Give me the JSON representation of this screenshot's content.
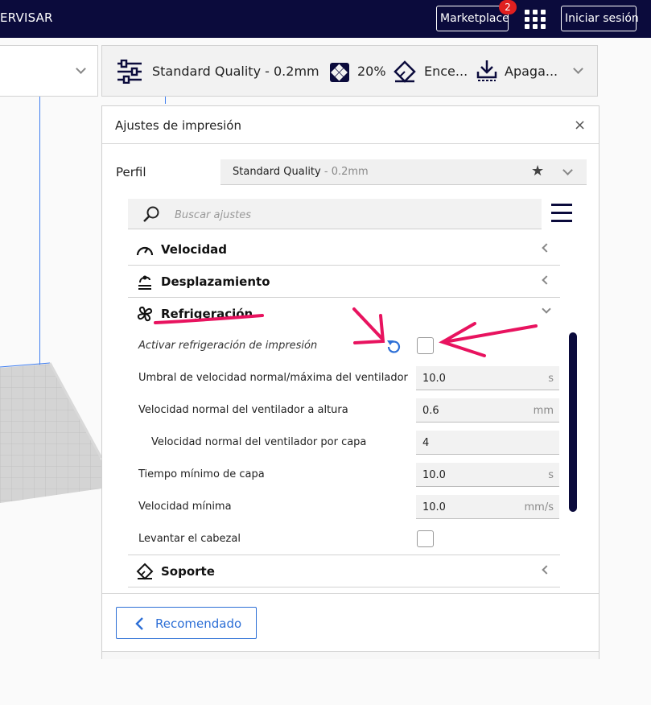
{
  "topbar": {
    "crumb": "ERVISAR",
    "marketplace_label": "Marketplace",
    "marketplace_badge": "2",
    "login_label": "Iniciar sesión"
  },
  "print_setup": {
    "profile": "Standard Quality - 0.2mm",
    "infill": "20%",
    "support": "Ence...",
    "adhesion": "Apaga..."
  },
  "panel": {
    "title": "Ajustes de impresión",
    "close": "×",
    "profile_label": "Perfil",
    "profile_name": "Standard Quality",
    "profile_layer": " - 0.2mm",
    "search_placeholder": "Buscar ajustes"
  },
  "categories": {
    "speed": "Velocidad",
    "travel": "Desplazamiento",
    "cooling": "Refrigeración",
    "support": "Soporte"
  },
  "cooling_settings": [
    {
      "label": "Activar refrigeración de impresión",
      "type": "checkbox",
      "checked": false
    },
    {
      "label": "Umbral de velocidad normal/máxima del ventilador",
      "value": "10.0",
      "unit": "s"
    },
    {
      "label": "Velocidad normal del ventilador a altura",
      "value": "0.6",
      "unit": "mm"
    },
    {
      "label": "Velocidad normal del ventilador por capa",
      "value": "4",
      "unit": ""
    },
    {
      "label": "Tiempo mínimo de capa",
      "value": "10.0",
      "unit": "s"
    },
    {
      "label": "Velocidad mínima",
      "value": "10.0",
      "unit": "mm/s"
    },
    {
      "label": "Levantar el cabezal",
      "type": "checkbox",
      "checked": false
    }
  ],
  "footer": {
    "recommended_label": "Recomendado"
  },
  "colors": {
    "topbar": "#0b0b3c",
    "accent_blue": "#2d6fd6",
    "annotation_pink": "#e8135f",
    "badge_red": "#e02020"
  }
}
